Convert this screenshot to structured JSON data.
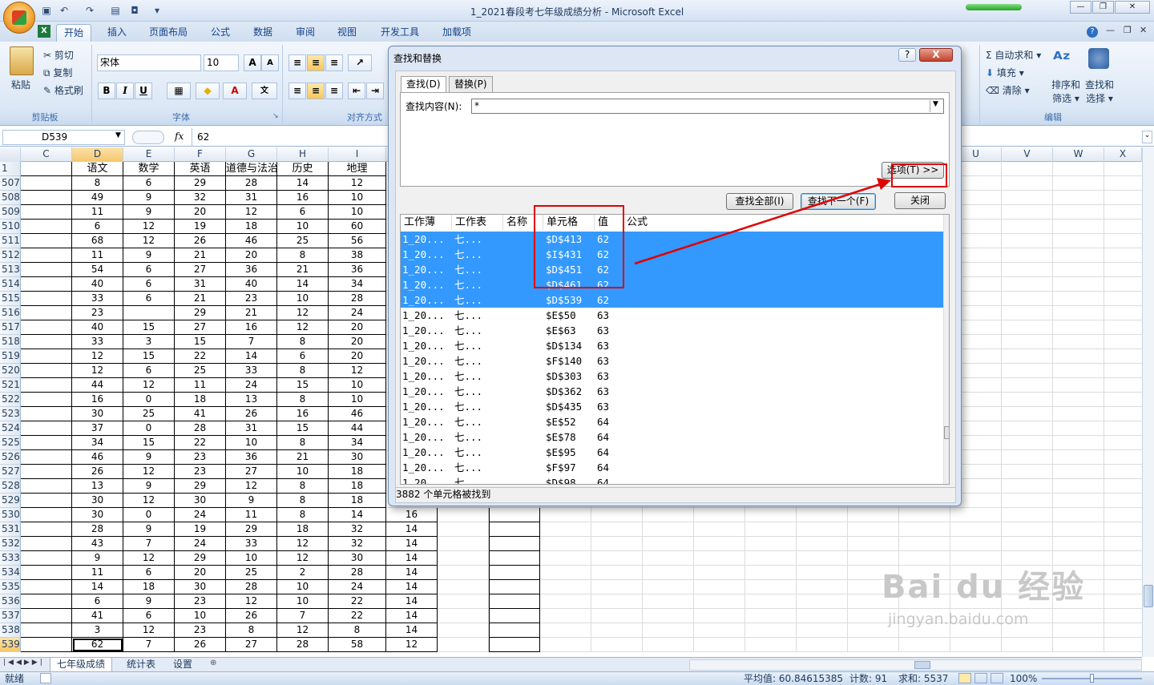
{
  "title": "1_2021春段考七年级成绩分析 - Microsoft Excel",
  "tabs": [
    "开始",
    "插入",
    "页面布局",
    "公式",
    "数据",
    "审阅",
    "视图",
    "开发工具",
    "加载项"
  ],
  "clipboard": {
    "paste": "粘贴",
    "cut": "剪切",
    "copy": "复制",
    "format_painter": "格式刷",
    "label": "剪贴板"
  },
  "font": {
    "name": "宋体",
    "size": "10",
    "label": "字体",
    "bold": "B",
    "italic": "I",
    "underline": "U"
  },
  "alignment": {
    "label": "对齐方式"
  },
  "editing": {
    "autosum": "自动求和",
    "fill": "填充",
    "clear": "清除",
    "sort_filter_1": "排序和",
    "sort_filter_2": "筛选",
    "find_select_1": "查找和",
    "find_select_2": "选择",
    "label": "编辑"
  },
  "formula": {
    "name_box": "D539",
    "fx": "fx",
    "value": "62"
  },
  "columns": [
    "C",
    "D",
    "E",
    "F",
    "G",
    "H",
    "I"
  ],
  "right_columns": [
    "U",
    "V",
    "W",
    "X"
  ],
  "header_row": {
    "num": "1",
    "cells": [
      "",
      "语文",
      "数学",
      "英语",
      "道德与法治",
      "历史",
      "地理"
    ]
  },
  "rows": [
    {
      "num": "507",
      "cells": [
        "",
        "8",
        "6",
        "29",
        "28",
        "14",
        "12"
      ]
    },
    {
      "num": "508",
      "cells": [
        "",
        "49",
        "9",
        "32",
        "31",
        "16",
        "10"
      ]
    },
    {
      "num": "509",
      "cells": [
        "",
        "11",
        "9",
        "20",
        "12",
        "6",
        "10"
      ]
    },
    {
      "num": "510",
      "cells": [
        "",
        "6",
        "12",
        "19",
        "18",
        "10",
        "60"
      ]
    },
    {
      "num": "511",
      "cells": [
        "",
        "68",
        "12",
        "26",
        "46",
        "25",
        "56"
      ]
    },
    {
      "num": "512",
      "cells": [
        "",
        "11",
        "9",
        "21",
        "20",
        "8",
        "38"
      ]
    },
    {
      "num": "513",
      "cells": [
        "",
        "54",
        "6",
        "27",
        "36",
        "21",
        "36"
      ]
    },
    {
      "num": "514",
      "cells": [
        "",
        "40",
        "6",
        "31",
        "40",
        "14",
        "34"
      ]
    },
    {
      "num": "515",
      "cells": [
        "",
        "33",
        "6",
        "21",
        "23",
        "10",
        "28"
      ]
    },
    {
      "num": "516",
      "cells": [
        "",
        "23",
        "",
        "29",
        "21",
        "12",
        "24"
      ]
    },
    {
      "num": "517",
      "cells": [
        "",
        "40",
        "15",
        "27",
        "16",
        "12",
        "20"
      ]
    },
    {
      "num": "518",
      "cells": [
        "",
        "33",
        "3",
        "15",
        "7",
        "8",
        "20"
      ]
    },
    {
      "num": "519",
      "cells": [
        "",
        "12",
        "15",
        "22",
        "14",
        "6",
        "20"
      ]
    },
    {
      "num": "520",
      "cells": [
        "",
        "12",
        "6",
        "25",
        "33",
        "8",
        "12"
      ]
    },
    {
      "num": "521",
      "cells": [
        "",
        "44",
        "12",
        "11",
        "24",
        "15",
        "10"
      ]
    },
    {
      "num": "522",
      "cells": [
        "",
        "16",
        "0",
        "18",
        "13",
        "8",
        "10"
      ]
    },
    {
      "num": "523",
      "cells": [
        "",
        "30",
        "25",
        "41",
        "26",
        "16",
        "46"
      ]
    },
    {
      "num": "524",
      "cells": [
        "",
        "37",
        "0",
        "28",
        "31",
        "15",
        "44"
      ]
    },
    {
      "num": "525",
      "cells": [
        "",
        "34",
        "15",
        "22",
        "10",
        "8",
        "34"
      ]
    },
    {
      "num": "526",
      "cells": [
        "",
        "46",
        "9",
        "23",
        "36",
        "21",
        "30"
      ]
    },
    {
      "num": "527",
      "cells": [
        "",
        "26",
        "12",
        "23",
        "27",
        "10",
        "18"
      ]
    },
    {
      "num": "528",
      "cells": [
        "",
        "13",
        "9",
        "29",
        "12",
        "8",
        "18"
      ]
    },
    {
      "num": "529",
      "cells": [
        "",
        "30",
        "12",
        "30",
        "9",
        "8",
        "18"
      ]
    },
    {
      "num": "530",
      "cells": [
        "",
        "30",
        "0",
        "24",
        "11",
        "8",
        "14",
        "16"
      ]
    },
    {
      "num": "531",
      "cells": [
        "",
        "28",
        "9",
        "19",
        "29",
        "18",
        "32",
        "14"
      ]
    },
    {
      "num": "532",
      "cells": [
        "",
        "43",
        "7",
        "24",
        "33",
        "12",
        "32",
        "14"
      ]
    },
    {
      "num": "533",
      "cells": [
        "",
        "9",
        "12",
        "29",
        "10",
        "12",
        "30",
        "14"
      ]
    },
    {
      "num": "534",
      "cells": [
        "",
        "11",
        "6",
        "20",
        "25",
        "2",
        "28",
        "14"
      ]
    },
    {
      "num": "535",
      "cells": [
        "",
        "14",
        "18",
        "30",
        "28",
        "10",
        "24",
        "14"
      ]
    },
    {
      "num": "536",
      "cells": [
        "",
        "6",
        "9",
        "23",
        "12",
        "10",
        "22",
        "14"
      ]
    },
    {
      "num": "537",
      "cells": [
        "",
        "41",
        "6",
        "10",
        "26",
        "7",
        "22",
        "14"
      ]
    },
    {
      "num": "538",
      "cells": [
        "",
        "3",
        "12",
        "23",
        "8",
        "12",
        "8",
        "14"
      ]
    },
    {
      "num": "539",
      "cells": [
        "",
        "62",
        "7",
        "26",
        "27",
        "28",
        "58",
        "12"
      ]
    }
  ],
  "sheet_tabs": [
    "七年级成绩",
    "统计表",
    "设置"
  ],
  "status": {
    "ready": "就绪",
    "average": "平均值: 60.84615385",
    "count": "计数: 91",
    "sum": "求和: 5537",
    "zoom": "100%"
  },
  "dialog": {
    "title": "查找和替换",
    "help": "?",
    "close_x": "X",
    "tab_find": "查找(D)",
    "tab_replace": "替换(P)",
    "find_label": "查找内容(N):",
    "find_value": "*",
    "options": "选项(T) >>",
    "find_all": "查找全部(I)",
    "find_next": "查找下一个(F)",
    "close": "关闭",
    "headers": [
      "工作薄",
      "工作表",
      "名称",
      "单元格",
      "值",
      "公式"
    ],
    "results": [
      {
        "book": "1_20...",
        "sheet": "七...",
        "cell": "$D$413",
        "value": "62",
        "hl": true
      },
      {
        "book": "1_20...",
        "sheet": "七...",
        "cell": "$I$431",
        "value": "62",
        "hl": true
      },
      {
        "book": "1_20...",
        "sheet": "七...",
        "cell": "$D$451",
        "value": "62",
        "hl": true
      },
      {
        "book": "1_20...",
        "sheet": "七...",
        "cell": "$D$461",
        "value": "62",
        "hl": true
      },
      {
        "book": "1_20...",
        "sheet": "七...",
        "cell": "$D$539",
        "value": "62",
        "hl": true
      },
      {
        "book": "1_20...",
        "sheet": "七...",
        "cell": "$E$50",
        "value": "63",
        "hl": false
      },
      {
        "book": "1_20...",
        "sheet": "七...",
        "cell": "$E$63",
        "value": "63",
        "hl": false
      },
      {
        "book": "1_20...",
        "sheet": "七...",
        "cell": "$D$134",
        "value": "63",
        "hl": false
      },
      {
        "book": "1_20...",
        "sheet": "七...",
        "cell": "$F$140",
        "value": "63",
        "hl": false
      },
      {
        "book": "1_20...",
        "sheet": "七...",
        "cell": "$D$303",
        "value": "63",
        "hl": false
      },
      {
        "book": "1_20...",
        "sheet": "七...",
        "cell": "$D$362",
        "value": "63",
        "hl": false
      },
      {
        "book": "1_20...",
        "sheet": "七...",
        "cell": "$D$435",
        "value": "63",
        "hl": false
      },
      {
        "book": "1_20...",
        "sheet": "七...",
        "cell": "$E$52",
        "value": "64",
        "hl": false
      },
      {
        "book": "1_20...",
        "sheet": "七...",
        "cell": "$E$78",
        "value": "64",
        "hl": false
      },
      {
        "book": "1_20...",
        "sheet": "七...",
        "cell": "$E$95",
        "value": "64",
        "hl": false
      },
      {
        "book": "1_20...",
        "sheet": "七...",
        "cell": "$F$97",
        "value": "64",
        "hl": false
      },
      {
        "book": "1_20...",
        "sheet": "七...",
        "cell": "$D$98",
        "value": "64",
        "hl": false
      },
      {
        "book": "1_20...",
        "sheet": "七...",
        "cell": "$D$105",
        "value": "64",
        "hl": false
      }
    ],
    "found_count": "3882 个单元格被找到"
  },
  "watermark": {
    "brand": "Bai du 经验",
    "url": "jingyan.baidu.com"
  }
}
